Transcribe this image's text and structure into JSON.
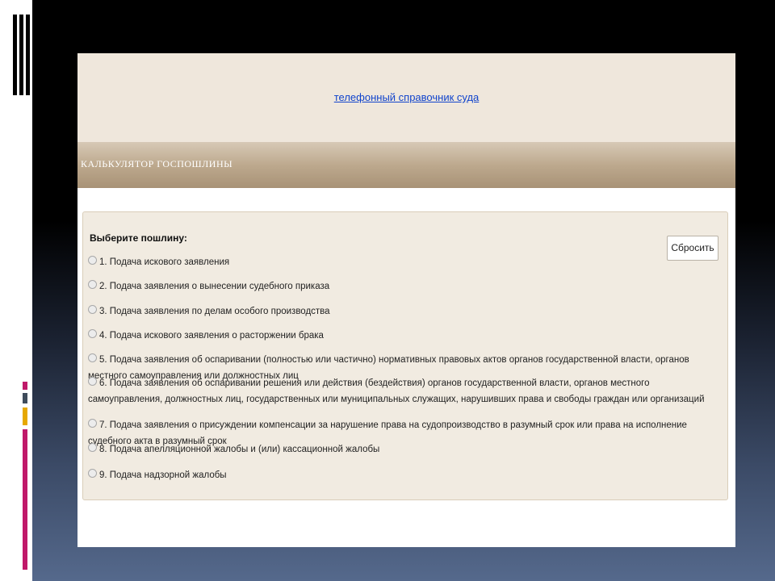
{
  "header": {
    "phone_directory_link": "телефонный справочник суда"
  },
  "calculator": {
    "title": "КАЛЬКУЛЯТОР ГОСПОШЛИНЫ",
    "prompt": "Выберите пошлину:",
    "reset_button": "Сбросить",
    "options": [
      "1. Подача искового заявления",
      "2. Подача заявления о вынесении судебного приказа",
      "3. Подача заявления по делам особого производства",
      "4. Подача искового заявления о расторжении брака",
      "5. Подача заявления об оспаривании (полностью или частично) нормативных правовых актов органов государственной власти, органов местного самоуправления или должностных лиц",
      "6. Подача заявления об оспаривании решения или действия (бездействия) органов государственной власти, органов местного самоуправления, должностных лиц, государственных или муниципальных служащих, нарушивших права и свободы граждан или организаций",
      "7. Подача заявления о присуждении компенсации за нарушение права на судопроизводство в разумный срок или права на исполнение судебного акта в разумный срок",
      "8. Подача апелляционной жалобы и (или) кассационной жалобы",
      "9. Подача надзорной жалобы"
    ]
  },
  "colors": {
    "link": "#1144cc",
    "header_band": "#efe7dc",
    "panel_background": "#f1ebe1",
    "accent_magenta": "#c0196a",
    "accent_gold": "#e6a800"
  }
}
